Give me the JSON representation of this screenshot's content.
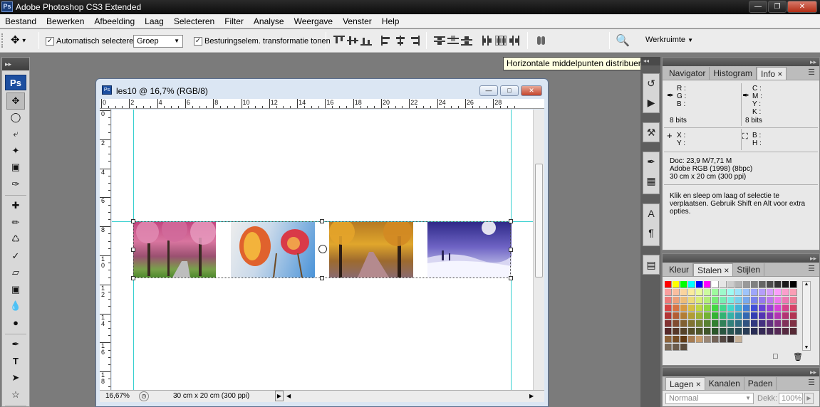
{
  "app": {
    "title": "Adobe Photoshop CS3 Extended",
    "logo": "Ps",
    "window_buttons": [
      "minimize-icon",
      "maximize-icon",
      "close-icon"
    ]
  },
  "menu": [
    "Bestand",
    "Bewerken",
    "Afbeelding",
    "Laag",
    "Selecteren",
    "Filter",
    "Analyse",
    "Weergave",
    "Venster",
    "Help"
  ],
  "options": {
    "auto_select_label": "Automatisch selecteren:",
    "auto_select_checked": true,
    "auto_select_value": "Groep",
    "transform_label": "Besturingselem. transformatie tonen",
    "transform_checked": true,
    "workspace_label": "Werkruimte"
  },
  "tooltip": "Horizontale middelpunten distribueren",
  "toolbox": {
    "logo": "Ps",
    "tools": [
      "move-tool",
      "marquee-tool",
      "lasso-tool",
      "magic-wand-tool",
      "crop-tool",
      "slice-tool",
      "healing-tool",
      "brush-tool",
      "stamp-tool",
      "history-brush-tool",
      "eraser-tool",
      "gradient-tool",
      "dodge-tool",
      "burn-tool",
      "pen-tool",
      "type-tool",
      "path-selection-tool",
      "shape-tool",
      "notes-tool"
    ]
  },
  "document": {
    "title": "les10 @ 16,7% (RGB/8)",
    "icon": "Ps",
    "ruler_top": [
      "0",
      "2",
      "4",
      "6",
      "8",
      "10",
      "12",
      "14",
      "16",
      "18",
      "20",
      "22",
      "24",
      "26",
      "28"
    ],
    "ruler_left": [
      "0",
      "2",
      "4",
      "6",
      "8",
      "1\n0",
      "1\n2",
      "1\n4",
      "1\n6",
      "1\n8"
    ],
    "zoom": "16,67%",
    "status": "30 cm x 20 cm (300 ppi)",
    "photos": [
      "cherry-blossom-photo",
      "tulips-photo",
      "autumn-road-photo",
      "winter-landscape-photo"
    ]
  },
  "info_panel": {
    "tabs": [
      "Navigator",
      "Histogram",
      "Info"
    ],
    "active_tab": "Info",
    "rgb_labels": "R :\nG :\nB :",
    "cmyk_labels": "C :\nM :\nY :\nK :",
    "bits_left": "8 bits",
    "bits_right": "8 bits",
    "xy_labels": "X :\nY :",
    "bh_labels": "B :\nH :",
    "doc_size": "Doc: 23,9 M/7,71 M",
    "color_profile": "Adobe RGB (1998) (8bpc)",
    "dimensions": "30 cm x 20 cm (300 ppi)",
    "hint": "Klik en sleep om laag of selectie te verplaatsen.  Gebruik Shift en Alt voor extra opties."
  },
  "swatches_panel": {
    "tabs": [
      "Kleur",
      "Stalen",
      "Stijlen"
    ],
    "active_tab": "Stalen"
  },
  "layers_panel": {
    "tabs": [
      "Lagen",
      "Kanalen",
      "Paden"
    ],
    "active_tab": "Lagen",
    "blend_mode": "Normaal",
    "opacity_label": "Dekk:",
    "opacity_value": "100%"
  }
}
